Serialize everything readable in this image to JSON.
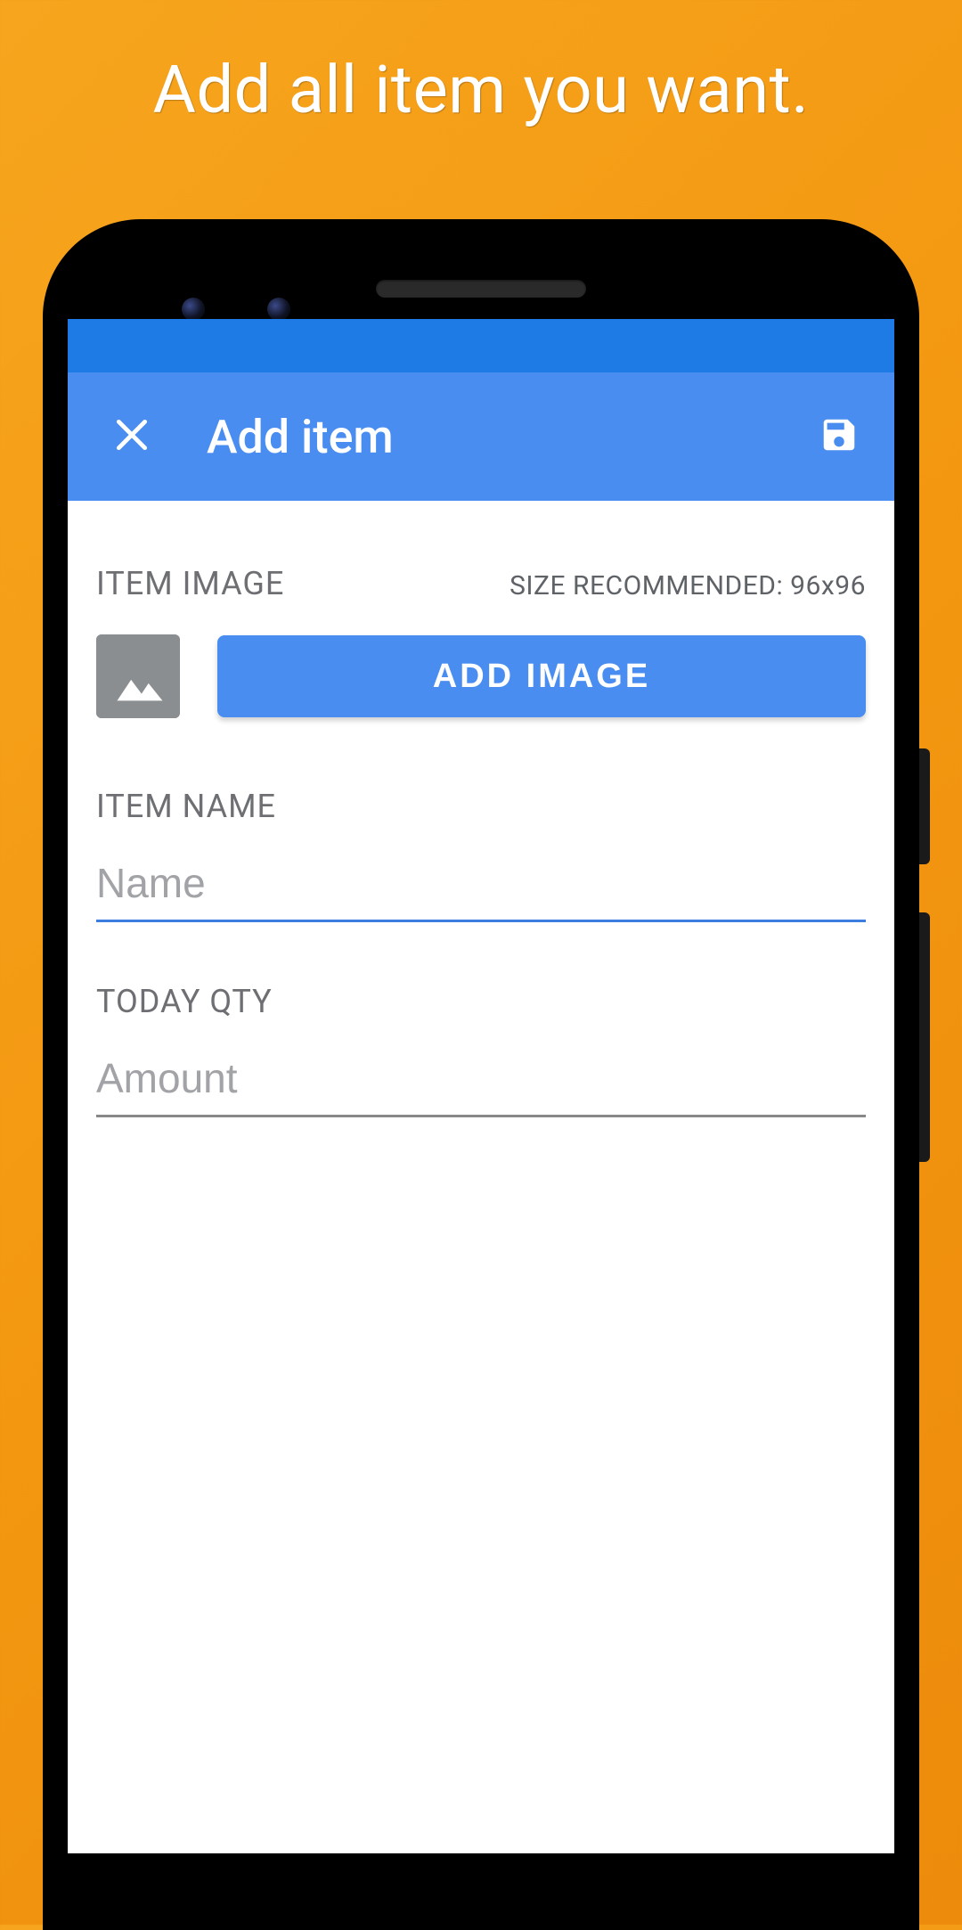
{
  "promo": {
    "heading": "Add all item you want."
  },
  "appbar": {
    "title": "Add item"
  },
  "image_section": {
    "label": "ITEM IMAGE",
    "hint": "SIZE RECOMMENDED: 96x96",
    "button_label": "ADD IMAGE"
  },
  "name_field": {
    "label": "ITEM NAME",
    "placeholder": "Name",
    "value": ""
  },
  "qty_field": {
    "label": "TODAY QTY",
    "placeholder": "Amount",
    "value": ""
  }
}
